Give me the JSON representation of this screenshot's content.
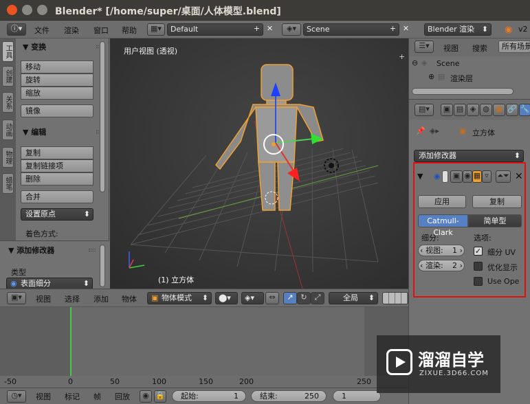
{
  "window": {
    "title": "Blender* [/home/super/桌面/人体模型.blend]"
  },
  "topbar": {
    "menu": [
      "文件",
      "渲染",
      "窗口",
      "帮助"
    ],
    "layout": "Default",
    "scene": "Scene",
    "engine": "Blender 渲染",
    "version": "v2"
  },
  "lefttabs": [
    "工具",
    "创建",
    "关系",
    "动画",
    "物理",
    "蜡笔"
  ],
  "transform": {
    "header": "▼ 变换",
    "buttons": [
      "移动",
      "旋转",
      "缩放"
    ],
    "mirror": "镜像"
  },
  "edit": {
    "header": "▼ 编辑",
    "buttons": [
      "复制",
      "复制链接项",
      "删除"
    ],
    "join": "合并",
    "set_origin": "设置原点",
    "shading": "着色方式:"
  },
  "addmod_panel": {
    "header": "▼ 添加修改器",
    "type_label": "类型",
    "type_value": "表面细分"
  },
  "viewport": {
    "view_label": "用户视图 (透视)",
    "object_label": "(1) 立方体",
    "plus": "+"
  },
  "vheader": {
    "menu": [
      "视图",
      "选择",
      "添加",
      "物体"
    ],
    "mode": "物体模式",
    "global": "全局"
  },
  "timeline": {
    "ticks": [
      "-50",
      "0",
      "50",
      "100",
      "150",
      "200",
      "250"
    ],
    "current_frame": 0
  },
  "tlfooter": {
    "menu": [
      "视图",
      "标记",
      "帧",
      "回放"
    ],
    "start": "起始:",
    "start_val": "1",
    "end": "结束:",
    "end_val": "250",
    "cur": "1"
  },
  "outliner": {
    "menu": [
      "视图",
      "搜索"
    ],
    "filter": "所有场景",
    "scene": "Scene",
    "render_layer": "渲染层"
  },
  "props": {
    "object": "立方体",
    "add_modifier": "添加修改器",
    "apply": "应用",
    "copy": "复制",
    "catmull": "Catmull-Clark",
    "simple": "简单型",
    "subdiv": "细分:",
    "view": "视图:",
    "view_val": "1",
    "render": "渲染:",
    "render_val": "2",
    "options": "选项:",
    "opt_uv": "细分 UV",
    "opt_opt": "优化显示",
    "opt_useope": "Use Ope"
  },
  "watermark": {
    "brand": "溜溜自学",
    "url": "ZIXUE.3D66.COM"
  },
  "colors": {
    "accent_blue": "#5680c2",
    "highlight_red": "#e01010",
    "playhead": "#44cc44",
    "orange": "#f0a030"
  }
}
